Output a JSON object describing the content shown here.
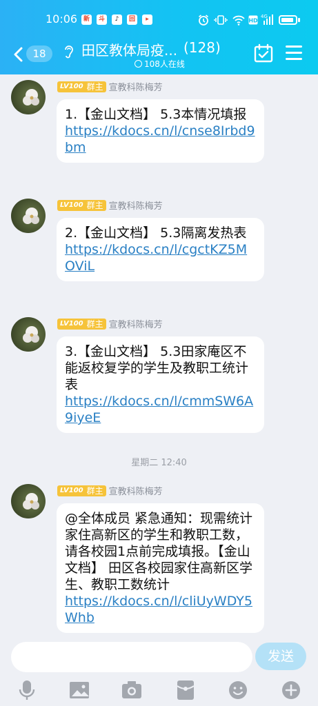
{
  "statusbar": {
    "time": "10:06",
    "notif_icons": [
      "新",
      "斗",
      "♪",
      "回",
      "▸"
    ],
    "battery_icon": "battery-icon"
  },
  "header": {
    "unread": "18",
    "title": "田区教体局疫...",
    "member_count": "(128)",
    "online": "108人在线",
    "accent_color": "#13c3f3"
  },
  "messages": [
    {
      "level": "LV100",
      "role": "群主",
      "sender": "宣教科陈梅芳",
      "text": "1.【金山文档】 5.3本情况填报",
      "link": "https://kdocs.cn/l/cnse8Irbd9bm"
    },
    {
      "level": "LV100",
      "role": "群主",
      "sender": "宣教科陈梅芳",
      "text": "2.【金山文档】 5.3隔离发热表",
      "link": "https://kdocs.cn/l/cgctKZ5MOViL"
    },
    {
      "level": "LV100",
      "role": "群主",
      "sender": "宣教科陈梅芳",
      "text": "3.【金山文档】 5.3田家庵区不能返校复学的学生及教职工统计表",
      "link": "https://kdocs.cn/l/cmmSW6A9iyeE"
    },
    {
      "level": "LV100",
      "role": "群主",
      "sender": "宣教科陈梅芳",
      "text": "@全体成员 紧急通知：现需统计家住高新区的学生和教职工数，请各校园1点前完成填报。【金山文档】 田区各校园家住高新区学生、教职工数统计",
      "link": "https://kdocs.cn/l/cliUyWDY5Whb"
    }
  ],
  "timestamp": "星期二 12:40",
  "input": {
    "placeholder": "",
    "send_label": "发送"
  }
}
